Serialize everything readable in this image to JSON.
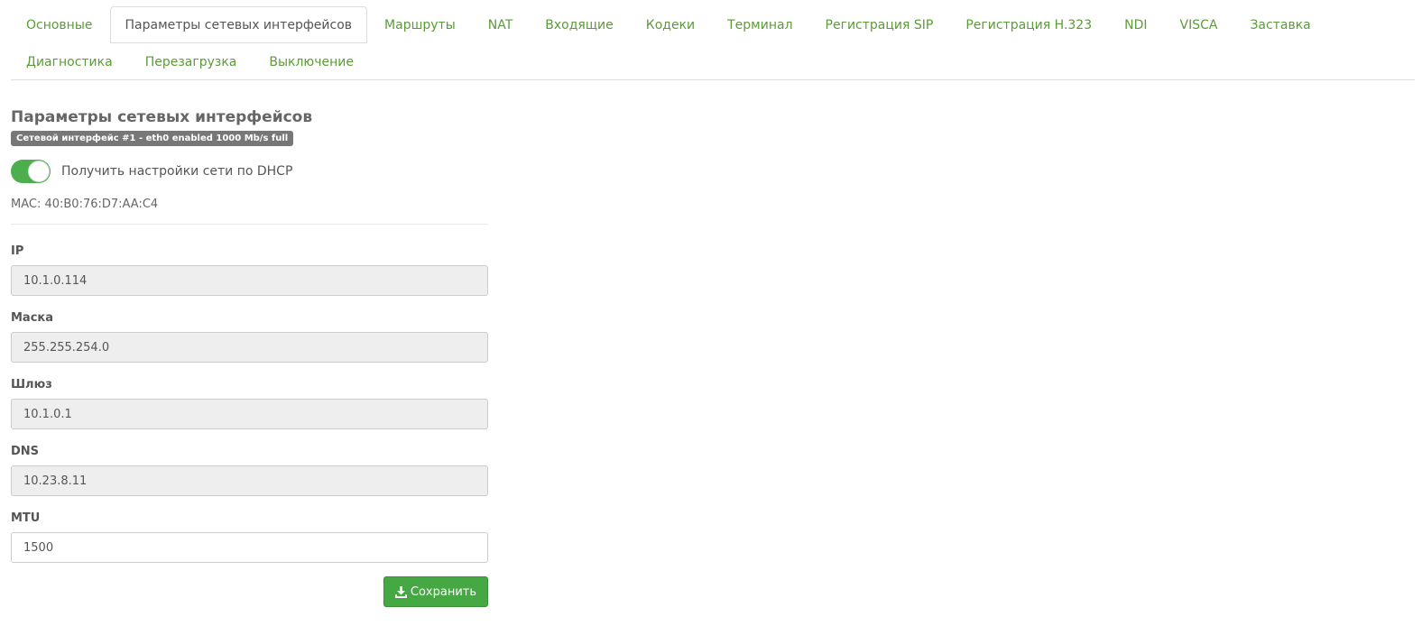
{
  "tabs": [
    {
      "label": "Основные",
      "active": false
    },
    {
      "label": "Параметры сетевых интерфейсов",
      "active": true
    },
    {
      "label": "Маршруты",
      "active": false
    },
    {
      "label": "NAT",
      "active": false
    },
    {
      "label": "Входящие",
      "active": false
    },
    {
      "label": "Кодеки",
      "active": false
    },
    {
      "label": "Терминал",
      "active": false
    },
    {
      "label": "Регистрация SIP",
      "active": false
    },
    {
      "label": "Регистрация H.323",
      "active": false
    },
    {
      "label": "NDI",
      "active": false
    },
    {
      "label": "VISCA",
      "active": false
    },
    {
      "label": "Заставка",
      "active": false
    },
    {
      "label": "Диагностика",
      "active": false
    },
    {
      "label": "Перезагрузка",
      "active": false
    },
    {
      "label": "Выключение",
      "active": false
    }
  ],
  "page": {
    "title": "Параметры сетевых интерфейсов",
    "interface_badge": "Сетевой интерфейс #1 - eth0 enabled 1000 Mb/s full",
    "dhcp_label": "Получить настройки сети по DHCP",
    "dhcp_enabled": true,
    "mac": "MAC: 40:B0:76:D7:AA:C4"
  },
  "fields": {
    "ip": {
      "label": "IP",
      "value": "10.1.0.114"
    },
    "mask": {
      "label": "Маска",
      "value": "255.255.254.0"
    },
    "gateway": {
      "label": "Шлюз",
      "value": "10.1.0.1"
    },
    "dns": {
      "label": "DNS",
      "value": "10.23.8.11"
    },
    "mtu": {
      "label": "MTU",
      "value": "1500"
    }
  },
  "actions": {
    "save_label": "Сохранить",
    "save_icon": "download-icon"
  },
  "colors": {
    "accent": "#5d9a3a",
    "toggle_on": "#4cae4c",
    "save_button": "#46a843",
    "badge": "#777777"
  }
}
